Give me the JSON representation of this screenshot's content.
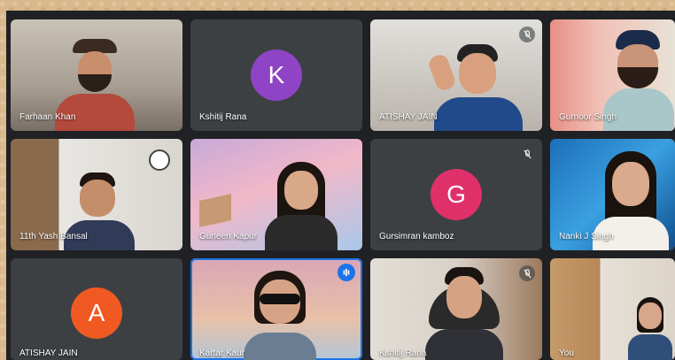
{
  "participants": [
    {
      "name": "Farhaan Khan"
    },
    {
      "name": "Kshitij Rana",
      "initial": "K"
    },
    {
      "name": "ATISHAY JAIN"
    },
    {
      "name": "Gurnoor Singh"
    },
    {
      "name": "11th Yash Bansal"
    },
    {
      "name": "Gurleen Kapur"
    },
    {
      "name": "Gursimran kamboz",
      "initial": "G"
    },
    {
      "name": "Nanki J Singh"
    },
    {
      "name": "ATISHAY JAIN",
      "initial": "A"
    },
    {
      "name": "Kartar Kaur"
    },
    {
      "name": "Kshitij Rana"
    },
    {
      "name": "You"
    }
  ],
  "colors": {
    "avatar_k": "#8e44c4",
    "avatar_g": "#e0306a",
    "avatar_a": "#f05a22",
    "speaking": "#1a73e8"
  }
}
